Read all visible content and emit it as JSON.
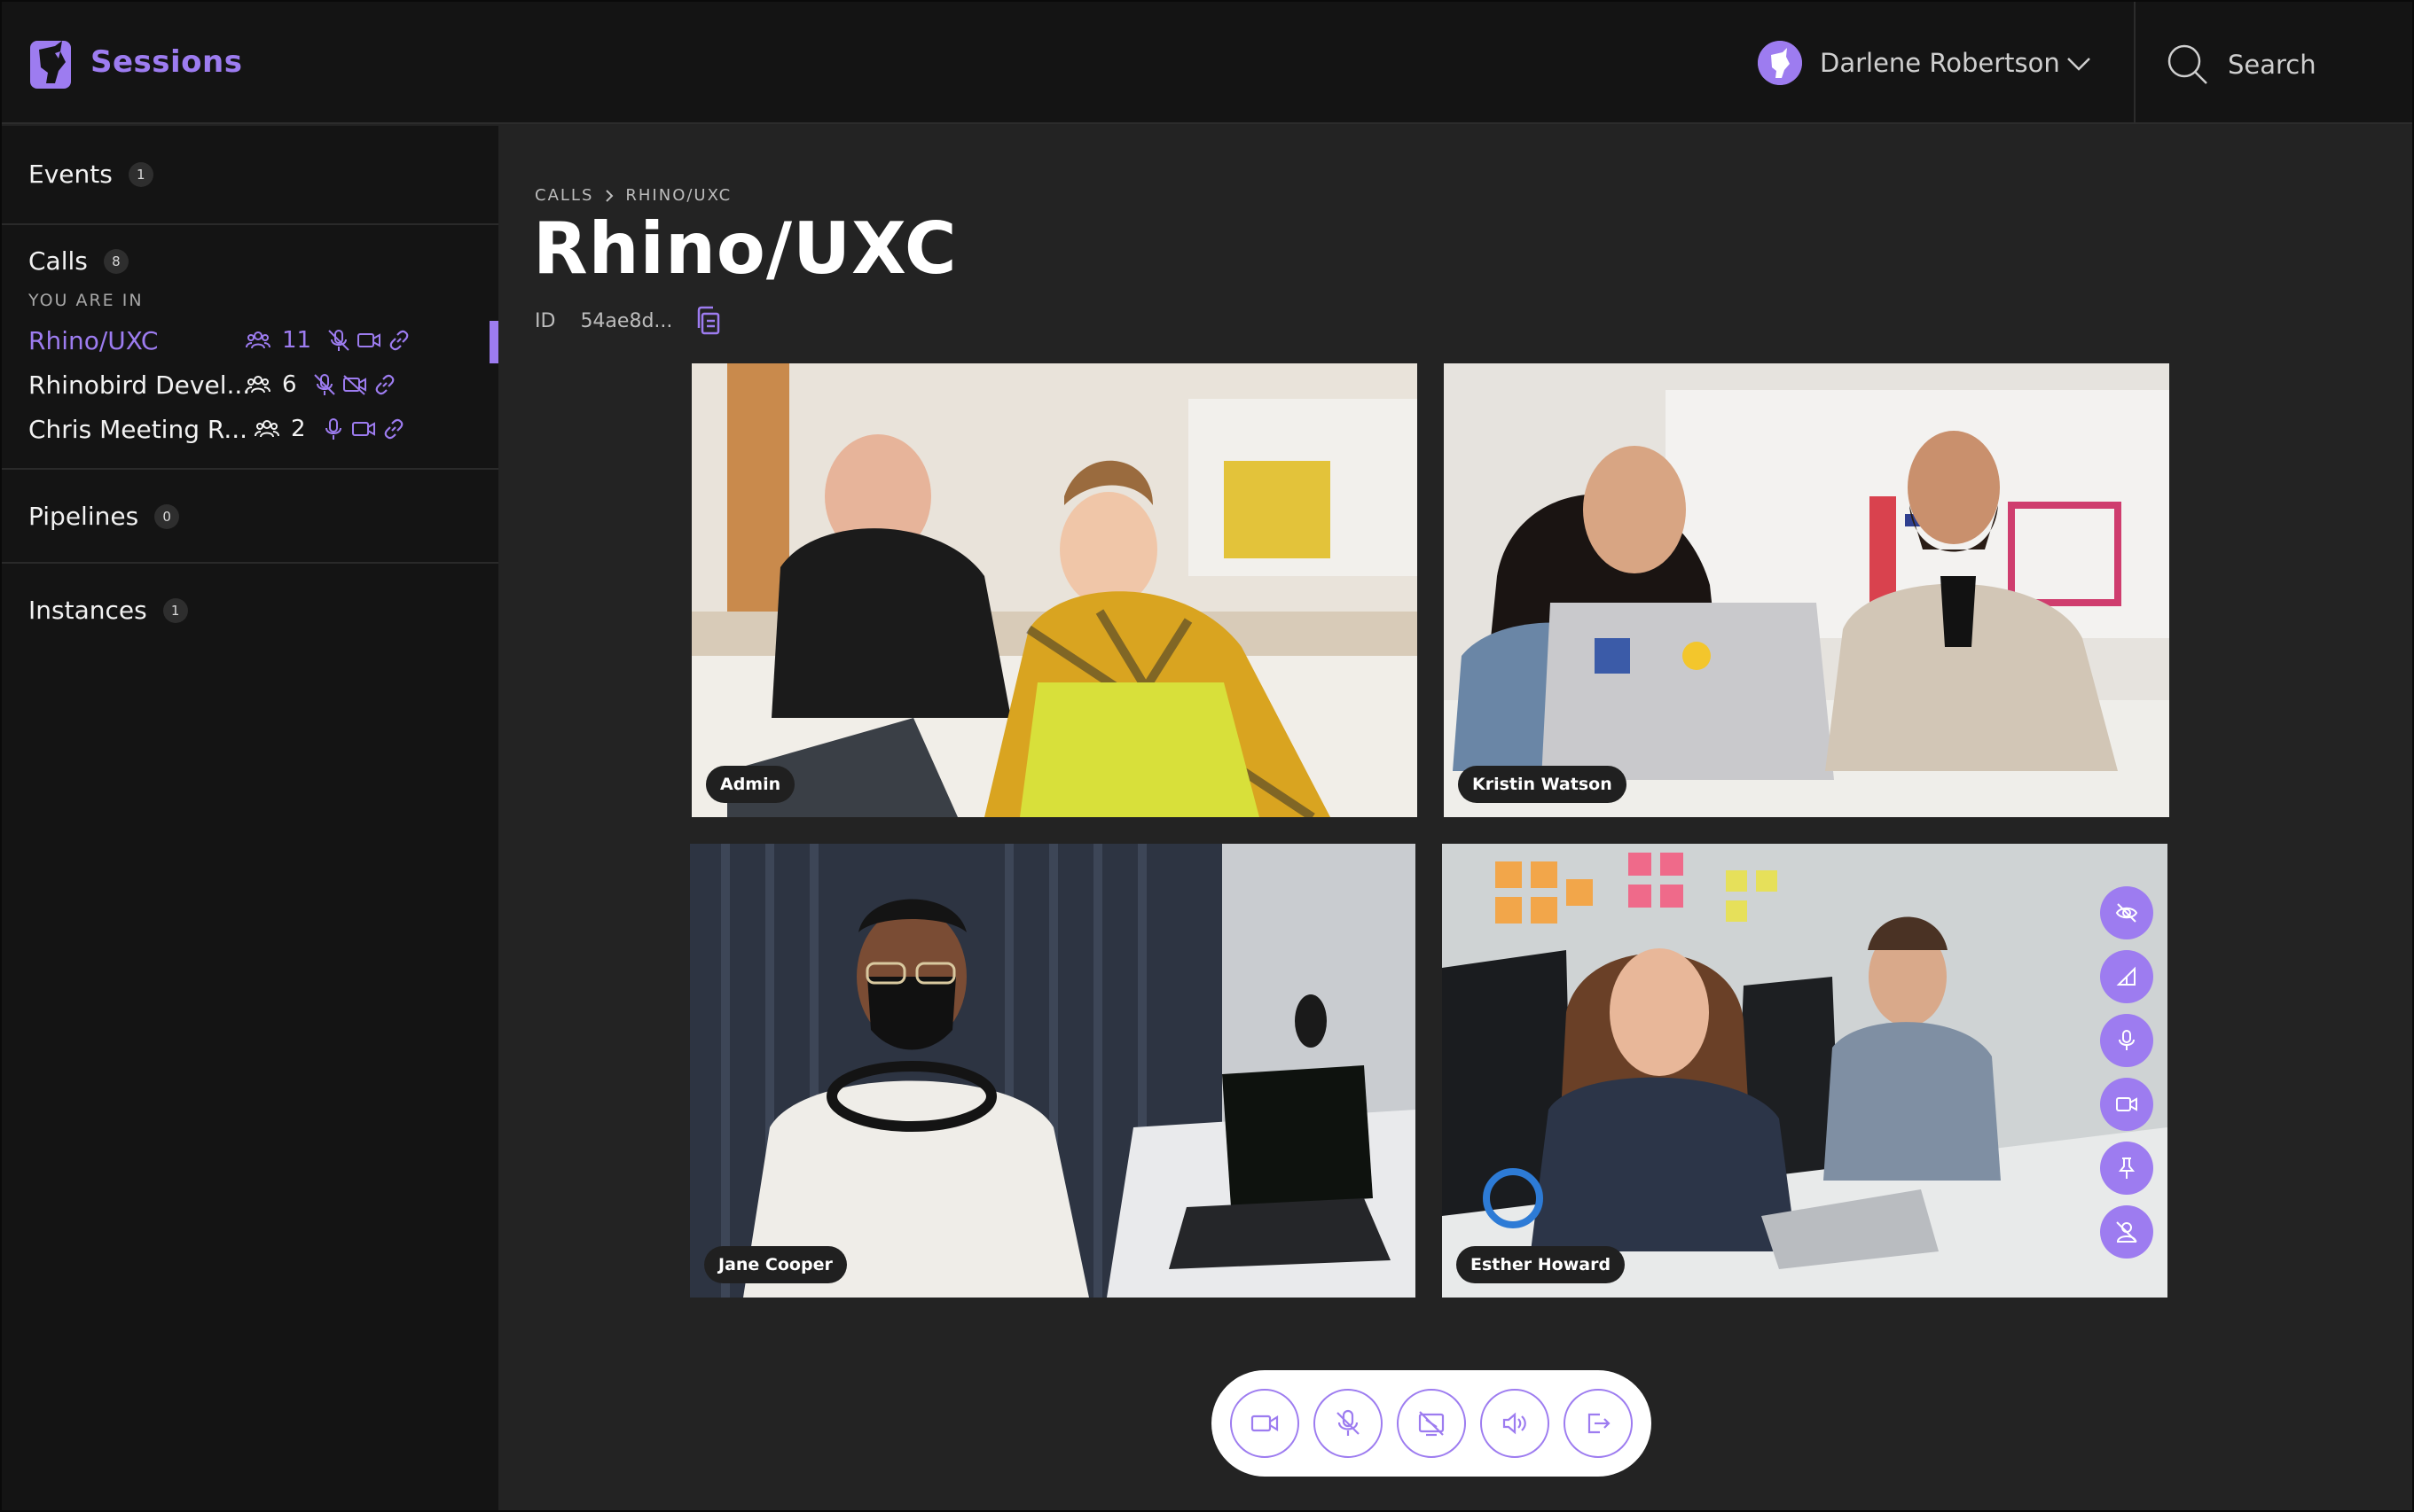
{
  "app": {
    "brand": "Sessions"
  },
  "header": {
    "user_name": "Darlene Robertson",
    "search_placeholder": "Search"
  },
  "sidebar": {
    "events": {
      "label": "Events",
      "count": "1"
    },
    "calls": {
      "label": "Calls",
      "count": "8",
      "you_are_in": "YOU ARE IN",
      "items": [
        {
          "name": "Rhino/UXC",
          "participants": "11",
          "active": true,
          "mic": "muted",
          "video": "on"
        },
        {
          "name": "Rhinobird Devel...",
          "participants": "6",
          "active": false,
          "mic": "muted",
          "video": "off"
        },
        {
          "name": "Chris Meeting R...",
          "participants": "2",
          "active": false,
          "mic": "on",
          "video": "on"
        }
      ]
    },
    "pipelines": {
      "label": "Pipelines",
      "count": "0"
    },
    "instances": {
      "label": "Instances",
      "count": "1"
    }
  },
  "main": {
    "breadcrumb": [
      "CALLS",
      "RHINO/UXC"
    ],
    "title": "Rhino/UXC",
    "id_label": "ID",
    "id_value": "54ae8d..."
  },
  "participants": [
    {
      "name": "Admin"
    },
    {
      "name": "Kristin Watson"
    },
    {
      "name": "Jane Cooper"
    },
    {
      "name": "Esther Howard"
    }
  ],
  "icons": {
    "tile_actions": [
      "eye-off-icon",
      "crop-icon",
      "mic-icon",
      "video-icon",
      "pin-icon",
      "remove-user-icon"
    ],
    "controls": [
      "video-icon",
      "mic-off-icon",
      "screen-share-off-icon",
      "speaker-icon",
      "exit-icon"
    ]
  },
  "colors": {
    "accent": "#9d7cf0",
    "background": "#232323",
    "panel": "#141414"
  }
}
